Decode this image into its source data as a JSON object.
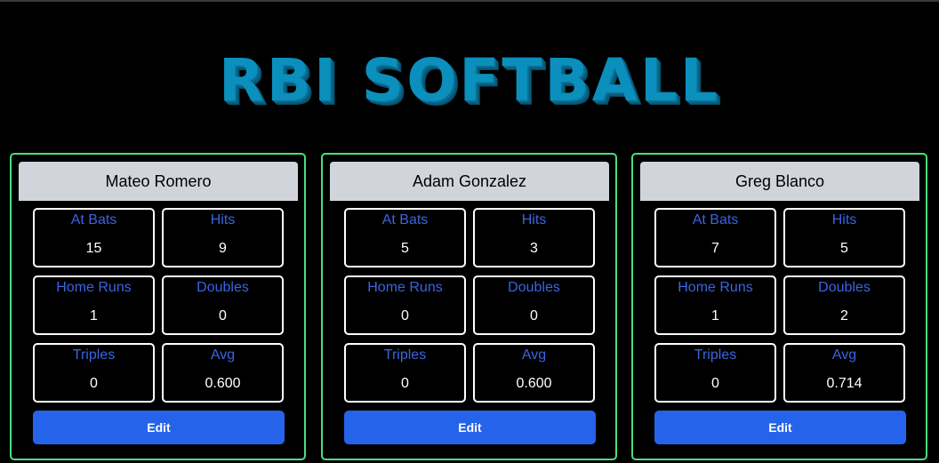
{
  "app_title": "RBI SOFTBALL",
  "colors": {
    "background": "#000000",
    "title": "#0b8fbd",
    "card_border": "#4ade80",
    "stat_label": "#3b64e0",
    "edit_button": "#2563eb",
    "header_bg": "#d1d5db"
  },
  "stat_labels": {
    "at_bats": "At Bats",
    "hits": "Hits",
    "home_runs": "Home Runs",
    "doubles": "Doubles",
    "triples": "Triples",
    "avg": "Avg"
  },
  "edit_label": "Edit",
  "players": [
    {
      "name": "Mateo Romero",
      "at_bats": "15",
      "hits": "9",
      "home_runs": "1",
      "doubles": "0",
      "triples": "0",
      "avg": "0.600"
    },
    {
      "name": "Adam Gonzalez",
      "at_bats": "5",
      "hits": "3",
      "home_runs": "0",
      "doubles": "0",
      "triples": "0",
      "avg": "0.600"
    },
    {
      "name": "Greg Blanco",
      "at_bats": "7",
      "hits": "5",
      "home_runs": "1",
      "doubles": "2",
      "triples": "0",
      "avg": "0.714"
    }
  ]
}
